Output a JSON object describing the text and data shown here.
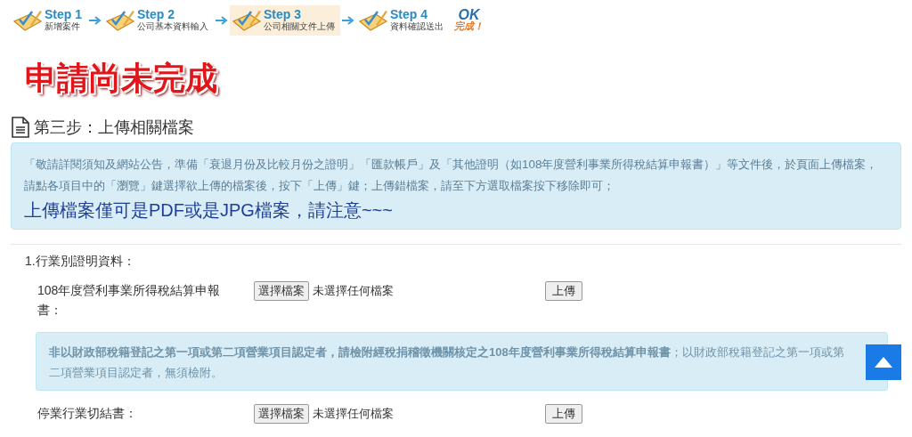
{
  "steps": [
    {
      "step": "Step 1",
      "label": "新增案件",
      "selected": false
    },
    {
      "step": "Step 2",
      "label": "公司基本資料輸入",
      "selected": false
    },
    {
      "step": "Step 3",
      "label": "公司相關文件上傳",
      "selected": true
    },
    {
      "step": "Step 4",
      "label": "資料確認送出",
      "selected": false
    }
  ],
  "finish": {
    "title": "OK",
    "label": "完成！"
  },
  "status_banner": "申請尚未完成",
  "section_title": "第三步：上傳相關檔案",
  "notice": {
    "text": "「敬請詳閱須知及網站公告，準備「衰退月份及比較月份之證明」「匯款帳戶」及「其他證明（如108年度營利事業所得稅結算申報書）」等文件後，於頁面上傳檔案，請點各項目中的「瀏覽」鍵選擇欲上傳的檔案後，按下「上傳」鍵；上傳錯檔案，請至下方選取檔案按下移除即可；",
    "emphasis": "上傳檔案僅可是PDF或是JPG檔案，請注意~~~"
  },
  "group": {
    "title": "1.行業別證明資料：",
    "items": [
      {
        "kind": "upload",
        "label": "108年度營利事業所得稅結算申報書：",
        "choose_button": "選擇檔案",
        "file_status": "未選擇任何檔案",
        "upload_button": "上傳"
      },
      {
        "kind": "note",
        "text": "**非以財政部稅籍登記之第一項或第二項營業項目認定者，請檢附經稅捐稽徵機關核定之108年度營利事業所得稅結算申報書**；以財政部稅籍登記之第一項或第二項營業項目認定者，無須檢附。"
      },
      {
        "kind": "upload",
        "label": "停業行業切結書：",
        "choose_button": "選擇檔案",
        "file_status": "未選擇任何檔案",
        "upload_button": "上傳"
      }
    ]
  }
}
